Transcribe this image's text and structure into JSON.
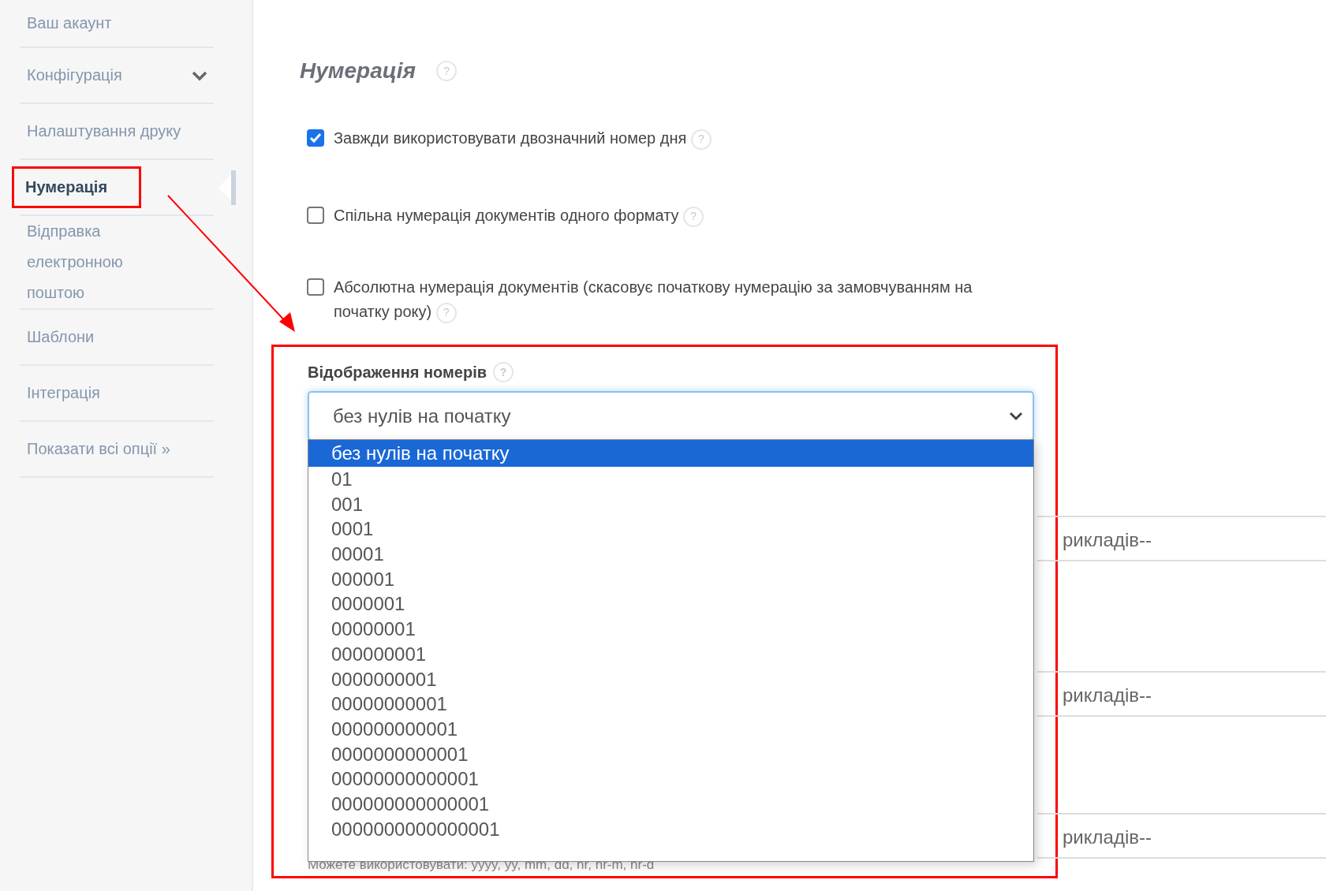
{
  "sidebar": {
    "items": [
      {
        "label": "Ваш акаунт",
        "kind": "link",
        "selected": false,
        "highlighted": false
      },
      {
        "label": "Конфігурація",
        "kind": "group",
        "selected": false,
        "highlighted": false
      },
      {
        "label": "Налаштування друку",
        "kind": "link",
        "selected": false,
        "highlighted": false
      },
      {
        "label": "Нумерація",
        "kind": "link",
        "selected": true,
        "highlighted": true
      },
      {
        "label": "Відправка електронною поштою",
        "kind": "link",
        "selected": false,
        "highlighted": false
      },
      {
        "label": "Шаблони",
        "kind": "link",
        "selected": false,
        "highlighted": false
      },
      {
        "label": "Інтеграція",
        "kind": "link",
        "selected": false,
        "highlighted": false
      },
      {
        "label": "Показати всі опції »",
        "kind": "link",
        "selected": false,
        "highlighted": false
      }
    ]
  },
  "content": {
    "heading": "Нумерація",
    "heading_help": "?",
    "options": [
      {
        "label": "Завжди використовувати двозначний номер дня",
        "checked": true,
        "help": "?"
      },
      {
        "label": "Спільна нумерація документів одного формату",
        "checked": false,
        "help": "?"
      },
      {
        "label": "Абсолютна нумерація документів (скасовує початкову нумерацію за замовчуванням на початку року)",
        "checked": false,
        "help": "?"
      }
    ],
    "display": {
      "label": "Відображення номерів",
      "help": "?",
      "value": "без нулів на початку",
      "expanded": true,
      "highlighted": true,
      "options": [
        {
          "label": "без нулів на початку",
          "selected": true
        },
        {
          "label": "01",
          "selected": false
        },
        {
          "label": "001",
          "selected": false
        },
        {
          "label": "0001",
          "selected": false
        },
        {
          "label": "00001",
          "selected": false
        },
        {
          "label": "000001",
          "selected": false
        },
        {
          "label": "0000001",
          "selected": false
        },
        {
          "label": "00000001",
          "selected": false
        },
        {
          "label": "000000001",
          "selected": false
        },
        {
          "label": "0000000001",
          "selected": false
        },
        {
          "label": "00000000001",
          "selected": false
        },
        {
          "label": "000000000001",
          "selected": false
        },
        {
          "label": "0000000000001",
          "selected": false
        },
        {
          "label": "00000000000001",
          "selected": false
        },
        {
          "label": "000000000000001",
          "selected": false
        },
        {
          "label": "0000000000000001",
          "selected": false
        }
      ]
    },
    "partial_fields": [
      {
        "value": "рикладів--"
      },
      {
        "value": "рикладів--"
      },
      {
        "value": "рикладів--"
      }
    ],
    "hint": "Можете використовувати: yyyy, yy, mm, dd, nr, nr-m, nr-d"
  }
}
